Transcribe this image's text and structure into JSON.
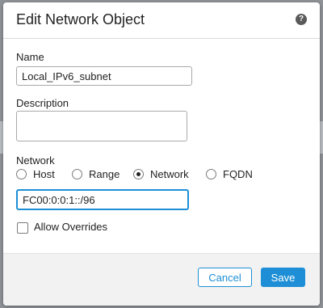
{
  "dialog": {
    "title": "Edit Network Object",
    "help_icon": "help-icon",
    "help_glyph": "?"
  },
  "form": {
    "name_label": "Name",
    "name_value": "Local_IPv6_subnet",
    "description_label": "Description",
    "description_value": "",
    "network_label": "Network",
    "network_types": [
      {
        "label": "Host",
        "checked": false
      },
      {
        "label": "Range",
        "checked": false
      },
      {
        "label": "Network",
        "checked": true
      },
      {
        "label": "FQDN",
        "checked": false
      }
    ],
    "network_value": "FC00:0:0:1::/96",
    "allow_overrides_label": "Allow Overrides",
    "allow_overrides_checked": false
  },
  "footer": {
    "cancel_label": "Cancel",
    "save_label": "Save"
  },
  "colors": {
    "accent": "#1e8fd6",
    "footer_bg": "#f2f2f2"
  }
}
